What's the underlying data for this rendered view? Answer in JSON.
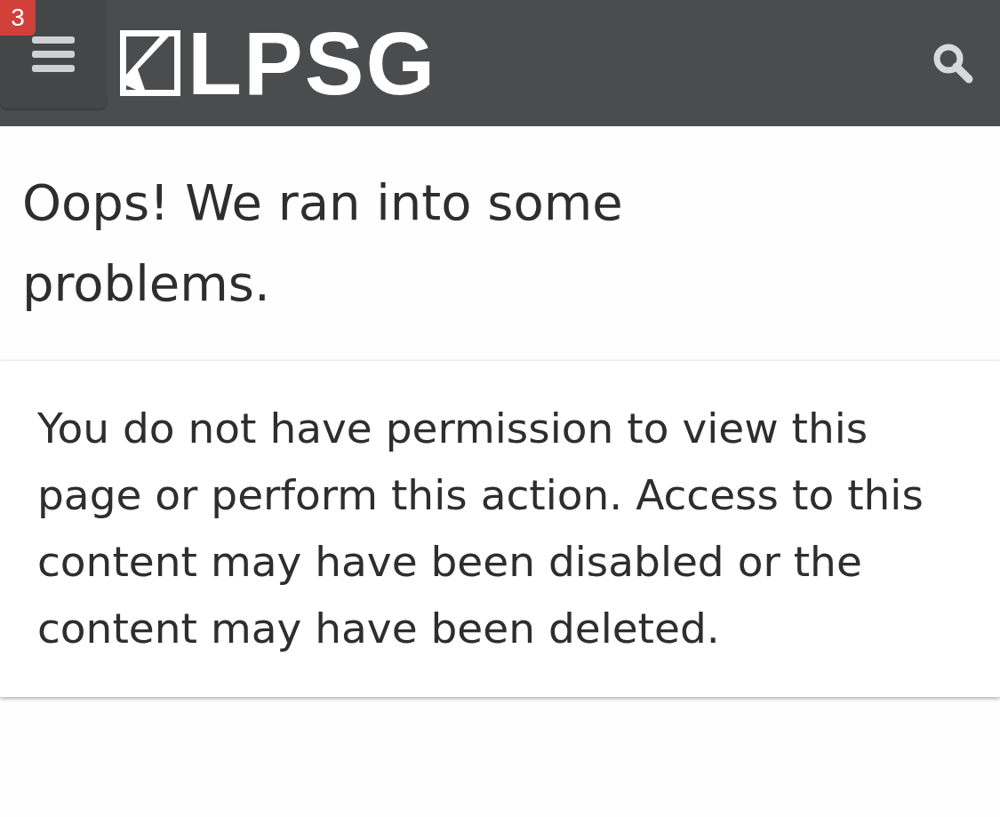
{
  "header": {
    "menu_badge": "3",
    "logo_text": "LPSG"
  },
  "title": "Oops! We ran into some problems.",
  "message": "You do not have permission to view this page or perform this action. Access to this content may have been disabled or the content may have been deleted."
}
